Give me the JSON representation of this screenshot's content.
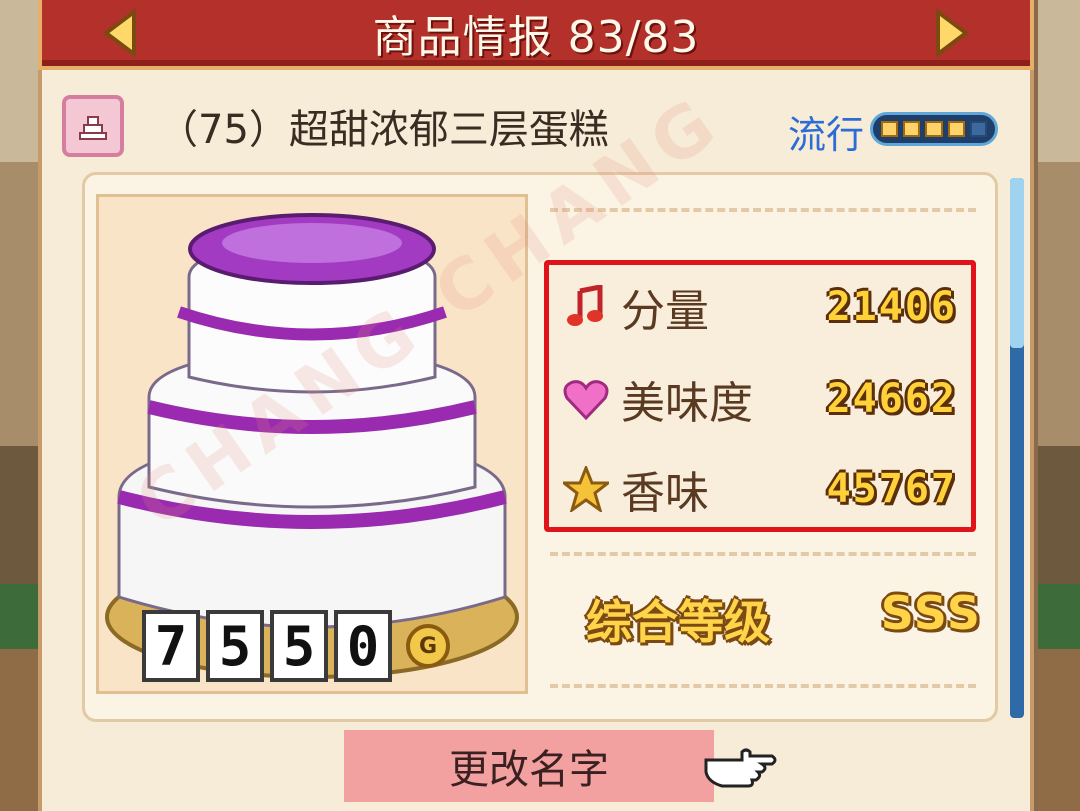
{
  "title": {
    "text": "商品情报 83/83",
    "prev_icon": "arrow-left-icon",
    "next_icon": "arrow-right-icon"
  },
  "item": {
    "category_icon": "cake-category-icon",
    "name": "（75）超甜浓郁三层蛋糕",
    "trend_label": "流行",
    "trend_level": 4,
    "trend_max": 5
  },
  "price": {
    "digits": [
      "7",
      "5",
      "5",
      "0"
    ],
    "currency": "G"
  },
  "stats": [
    {
      "icon": "music-note-icon",
      "label": "分量",
      "value": "21406"
    },
    {
      "icon": "heart-icon",
      "label": "美味度",
      "value": "24662"
    },
    {
      "icon": "star-icon",
      "label": "香味",
      "value": "45767"
    }
  ],
  "grade": {
    "label": "综合等级",
    "value": "SSS"
  },
  "rename_button": "更改名字",
  "watermark": "CHANG CHANG",
  "colors": {
    "title_bar": "#b4302a",
    "highlight_box": "#e0121a",
    "trend_text": "#2b6cd6",
    "gold_text": "#ffd23a"
  }
}
